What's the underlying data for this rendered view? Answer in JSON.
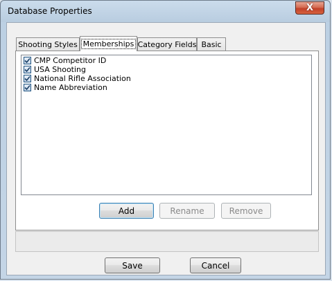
{
  "window": {
    "title": "Database Properties",
    "close_glyph": "X"
  },
  "tabs": [
    {
      "label": "Shooting Styles",
      "active": false
    },
    {
      "label": "Memberships",
      "active": true
    },
    {
      "label": "Category Fields",
      "active": false
    },
    {
      "label": "Basic",
      "active": false
    }
  ],
  "memberships": {
    "items": [
      {
        "label": "CMP Competitor ID",
        "checked": true
      },
      {
        "label": "USA Shooting",
        "checked": true
      },
      {
        "label": "National Rifle Association",
        "checked": true
      },
      {
        "label": "Name Abbreviation",
        "checked": true
      }
    ],
    "add_label": "Add",
    "rename_label": "Rename",
    "remove_label": "Remove"
  },
  "footer": {
    "status_text": "",
    "save_label": "Save",
    "cancel_label": "Cancel"
  },
  "colors": {
    "close_button": "#c2412a",
    "checkbox_border": "#1c5180"
  },
  "icons": {
    "close": "close-icon",
    "check": "checkmark-icon"
  }
}
